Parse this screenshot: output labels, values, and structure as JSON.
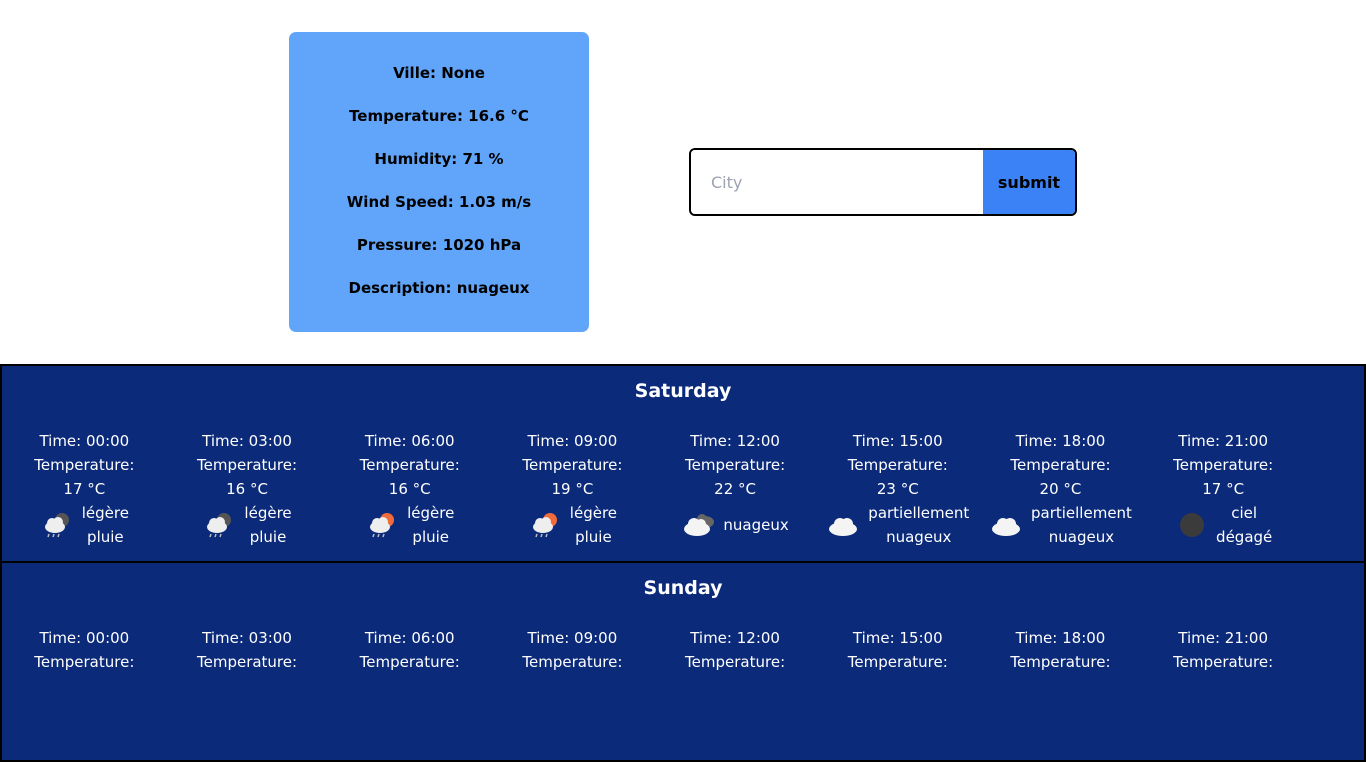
{
  "current": {
    "city": "Ville: None",
    "temperature": "Temperature: 16.6 °C",
    "humidity": "Humidity: 71 %",
    "wind": "Wind Speed: 1.03 m/s",
    "pressure": "Pressure: 1020 hPa",
    "description": "Description: nuageux"
  },
  "search": {
    "placeholder": "City",
    "value": "",
    "button": "submit"
  },
  "forecast": [
    {
      "day": "Saturday",
      "slots": [
        {
          "time": "Time: 00:00",
          "temp_label": "Temperature:",
          "temp": "17 °C",
          "desc": [
            "légère",
            "pluie"
          ],
          "icon": "cloud-rain-night-icon"
        },
        {
          "time": "Time: 03:00",
          "temp_label": "Temperature:",
          "temp": "16 °C",
          "desc": [
            "légère",
            "pluie"
          ],
          "icon": "cloud-rain-night-icon"
        },
        {
          "time": "Time: 06:00",
          "temp_label": "Temperature:",
          "temp": "16 °C",
          "desc": [
            "légère",
            "pluie"
          ],
          "icon": "cloud-rain-sun-icon"
        },
        {
          "time": "Time: 09:00",
          "temp_label": "Temperature:",
          "temp": "19 °C",
          "desc": [
            "légère",
            "pluie"
          ],
          "icon": "cloud-rain-sun-icon"
        },
        {
          "time": "Time: 12:00",
          "temp_label": "Temperature:",
          "temp": "22 °C",
          "desc": [
            "nuageux"
          ],
          "icon": "broken-clouds-icon"
        },
        {
          "time": "Time: 15:00",
          "temp_label": "Temperature:",
          "temp": "23 °C",
          "desc": [
            "partiellement",
            "nuageux"
          ],
          "icon": "cloud-icon"
        },
        {
          "time": "Time: 18:00",
          "temp_label": "Temperature:",
          "temp": "20 °C",
          "desc": [
            "partiellement",
            "nuageux"
          ],
          "icon": "cloud-icon"
        },
        {
          "time": "Time: 21:00",
          "temp_label": "Temperature:",
          "temp": "17 °C",
          "desc": [
            "ciel",
            "dégagé"
          ],
          "icon": "clear-night-moon-icon"
        }
      ]
    },
    {
      "day": "Sunday",
      "slots": [
        {
          "time": "Time: 00:00",
          "temp_label": "Temperature:"
        },
        {
          "time": "Time: 03:00",
          "temp_label": "Temperature:"
        },
        {
          "time": "Time: 06:00",
          "temp_label": "Temperature:"
        },
        {
          "time": "Time: 09:00",
          "temp_label": "Temperature:"
        },
        {
          "time": "Time: 12:00",
          "temp_label": "Temperature:"
        },
        {
          "time": "Time: 15:00",
          "temp_label": "Temperature:"
        },
        {
          "time": "Time: 18:00",
          "temp_label": "Temperature:"
        },
        {
          "time": "Time: 21:00",
          "temp_label": "Temperature:"
        }
      ]
    }
  ]
}
